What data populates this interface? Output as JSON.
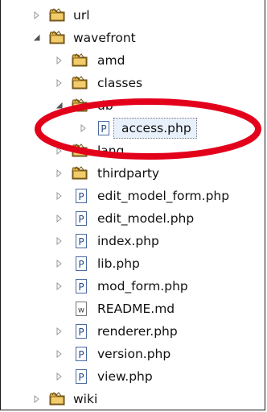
{
  "tree": {
    "items": [
      {
        "label": "url",
        "type": "folder",
        "expanded": false
      },
      {
        "label": "wavefront",
        "type": "folder",
        "expanded": true
      },
      {
        "label": "amd",
        "type": "folder",
        "expanded": false
      },
      {
        "label": "classes",
        "type": "folder",
        "expanded": false
      },
      {
        "label": "db",
        "type": "folder",
        "expanded": true
      },
      {
        "label": "access.php",
        "type": "php-file",
        "expanded": false,
        "selected": true
      },
      {
        "label": "lang",
        "type": "folder",
        "expanded": false
      },
      {
        "label": "thirdparty",
        "type": "folder",
        "expanded": false
      },
      {
        "label": "edit_model_form.php",
        "type": "php-file",
        "expanded": false
      },
      {
        "label": "edit_model.php",
        "type": "php-file",
        "expanded": false
      },
      {
        "label": "index.php",
        "type": "php-file",
        "expanded": false
      },
      {
        "label": "lib.php",
        "type": "php-file",
        "expanded": false
      },
      {
        "label": "mod_form.php",
        "type": "php-file",
        "expanded": false
      },
      {
        "label": "README.md",
        "type": "text-file"
      },
      {
        "label": "renderer.php",
        "type": "php-file",
        "expanded": false
      },
      {
        "label": "version.php",
        "type": "php-file",
        "expanded": false
      },
      {
        "label": "view.php",
        "type": "php-file",
        "expanded": false
      },
      {
        "label": "wiki",
        "type": "folder",
        "expanded": false
      }
    ]
  },
  "colors": {
    "annotation_ellipse": "#e3001b",
    "folder_fill": "#e0b04a",
    "php_icon_border": "#4a6aa0",
    "selection_bg": "#e8f0fb"
  }
}
